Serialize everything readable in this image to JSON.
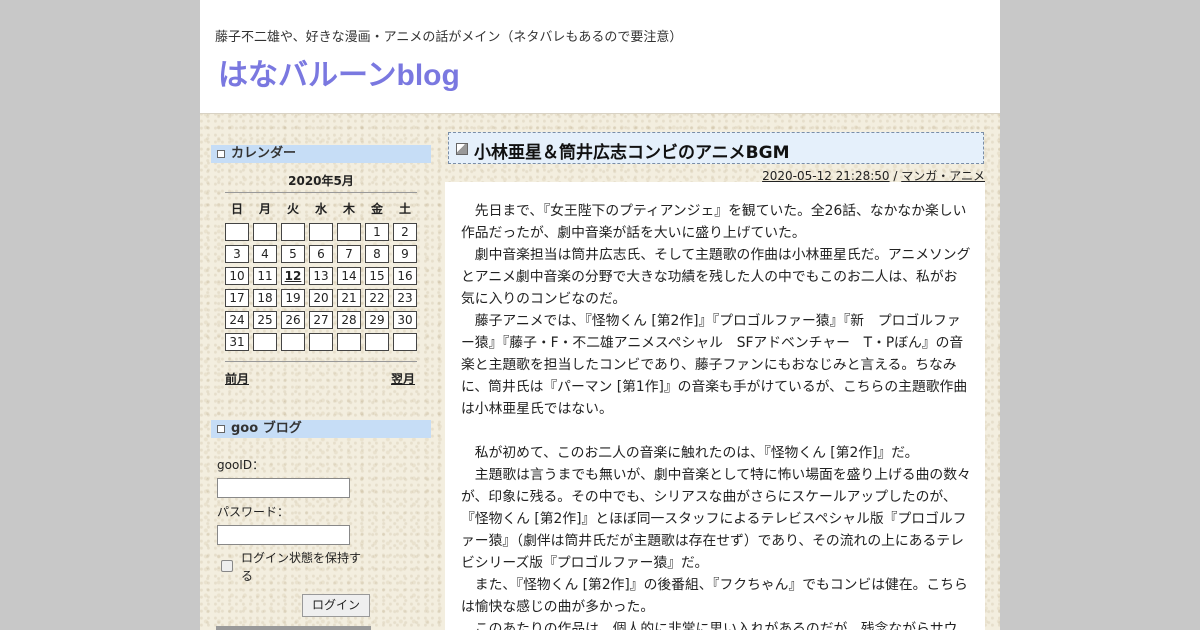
{
  "header": {
    "description": "藤子不二雄や、好きな漫画・アニメの話がメイン（ネタバレもあるので要注意）",
    "title": "はなバルーンblog"
  },
  "sidebar": {
    "calendar": {
      "heading": "カレンダー",
      "month_title": "2020年5月",
      "weekdays": [
        "日",
        "月",
        "火",
        "水",
        "木",
        "金",
        "土"
      ],
      "days": [
        "",
        "",
        "",
        "",
        "",
        "1",
        "2",
        "3",
        "4",
        "5",
        "6",
        "7",
        "8",
        "9",
        "10",
        "11",
        "12",
        "13",
        "14",
        "15",
        "16",
        "17",
        "18",
        "19",
        "20",
        "21",
        "22",
        "23",
        "24",
        "25",
        "26",
        "27",
        "28",
        "29",
        "30",
        "31",
        "",
        "",
        "",
        "",
        "",
        ""
      ],
      "highlighted_day": "12",
      "prev_label": "前月",
      "next_label": "翌月"
    },
    "login": {
      "heading": "goo ブログ",
      "id_label": "gooID：",
      "id_value": "",
      "password_label": "パスワード：",
      "password_value": "",
      "keep_login_label": "ログイン状態を保持する",
      "keep_login_checked": false,
      "button_label": "ログイン"
    }
  },
  "post": {
    "title": "小林亜星＆筒井広志コンビのアニメBGM",
    "datetime": "2020-05-12 21:28:50",
    "separator": " / ",
    "category": "マンガ・アニメ",
    "paragraphs": [
      "先日まで、『女王陛下のプティアンジェ』を観ていた。全26話、なかなか楽しい作品だったが、劇中音楽が話を大いに盛り上げていた。",
      "劇中音楽担当は筒井広志氏、そして主題歌の作曲は小林亜星氏だ。アニメソングとアニメ劇中音楽の分野で大きな功績を残した人の中でもこのお二人は、私がお気に入りのコンビなのだ。",
      "藤子アニメでは、『怪物くん [第2作]』『プロゴルファー猿』『新　プロゴルファー猿』『藤子・F・不二雄アニメスペシャル　SFアドベンチャー　T・Pぼん』の音楽と主題歌を担当したコンビであり、藤子ファンにもおなじみと言える。ちなみに、筒井氏は『パーマン [第1作]』の音楽も手がけているが、こちらの主題歌作曲は小林亜星氏ではない。",
      "",
      "私が初めて、このお二人の音楽に触れたのは、『怪物くん [第2作]』だ。",
      "主題歌は言うまでも無いが、劇中音楽として特に怖い場面を盛り上げる曲の数々が、印象に残る。その中でも、シリアスな曲がさらにスケールアップしたのが、『怪物くん [第2作]』とほぼ同一スタッフによるテレビスペシャル版『プロゴルファー猿』（劇伴は筒井氏だが主題歌は存在せず）であり、その流れの上にあるテレビシリーズ版『プロゴルファー猿』だ。",
      "また、『怪物くん [第2作]』の後番組、『フクちゃん』でもコンビは健在。こちらは愉快な感じの曲が多かった。",
      "このあたりの作品は、個人的に非常に思い入れがあるのだが、残念ながらサウ"
    ]
  }
}
